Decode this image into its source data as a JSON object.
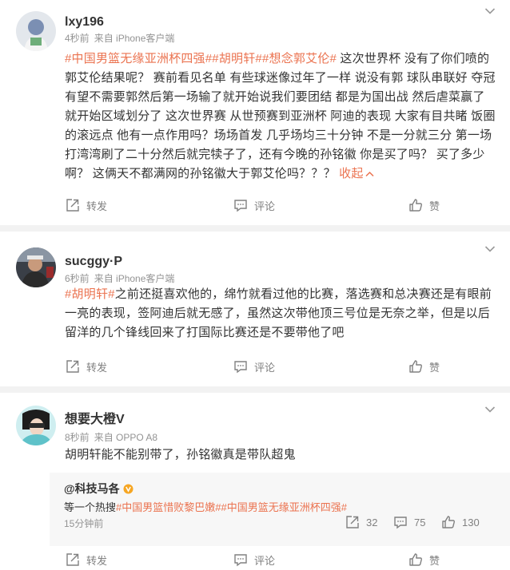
{
  "posts": [
    {
      "username": "lxy196",
      "time": "4秒前",
      "source": "来自 iPhone客户端",
      "tags": "#中国男篮无缘亚洲杯四强##胡明轩##想念郭艾伦#",
      "text": " 这次世界杯 没有了你们喷的郭艾伦结果呢？ 赛前看见名单 有些球迷像过年了一样 说没有郭 球队串联好 夺冠有望不需要郭然后第一场输了就开始说我们要团结 都是为国出战 然后虐菜赢了 就开始区域划分了 这次世界赛 从世预赛到亚洲杯 阿迪的表现 大家有目共睹 饭圈的滚远点 他有一点作用吗？场场首发 几乎场均三十分钟 不是一分就三分 第一场打湾湾刷了二十分然后就完犊子了，还有今晚的孙铭徽 你是买了吗？ 买了多少啊？ 这俩天不都满网的孙铭徽大于郭艾伦吗？？？",
      "collapse": "收起",
      "share": "转发",
      "comment": "评论",
      "like": "赞"
    },
    {
      "username": "sucggy·P",
      "time": "6秒前",
      "source": "来自 iPhone客户端",
      "tags": "#胡明轩#",
      "text": "之前还挺喜欢他的，绵竹就看过他的比赛，落选赛和总决赛还是有眼前一亮的表现，签阿迪后就无感了，虽然这次带他顶三号位是无奈之举，但是以后留洋的几个锋线回来了打国际比赛还是不要带他了吧",
      "share": "转发",
      "comment": "评论",
      "like": "赞"
    },
    {
      "username": "想要大橙V",
      "time": "8秒前",
      "source": "来自 OPPO A8",
      "text": "胡明轩能不能别带了，孙铭徽真是带队超鬼",
      "share": "转发",
      "comment": "评论",
      "like": "赞",
      "repost": {
        "username": "@科技马各",
        "text_prefix": "等一个热搜",
        "tags": "#中国男篮惜败黎巴嫩##中国男篮无缘亚洲杯四强#",
        "time": "15分钟前",
        "share_count": "32",
        "comment_count": "75",
        "like_count": "130"
      }
    }
  ],
  "colors": {
    "accent": "#eb7350",
    "meta": "#939393",
    "action": "#808080",
    "divider": "#f2f2f2",
    "badge": "#f6a623"
  },
  "icons": [
    "chevron-down-icon",
    "share-icon",
    "comment-icon",
    "like-icon",
    "verified-badge-icon",
    "collapse-caret-icon"
  ]
}
